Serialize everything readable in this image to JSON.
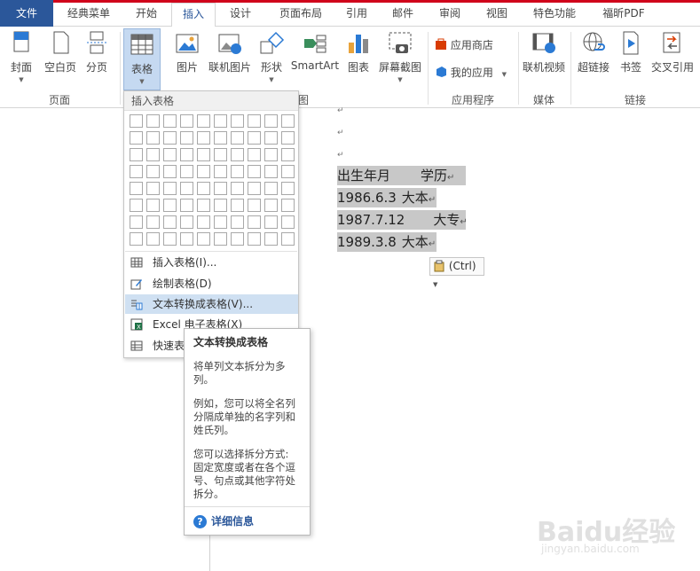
{
  "tabs": [
    "文件",
    "经典菜单",
    "开始",
    "插入",
    "设计",
    "页面布局",
    "引用",
    "邮件",
    "审阅",
    "视图",
    "特色功能",
    "福昕PDF"
  ],
  "ribbon": {
    "pages_group": [
      "封面",
      "空白页",
      "分页"
    ],
    "pages_label": "页面",
    "table_label": "表格",
    "illustrations": [
      "图片",
      "联机图片",
      "形状",
      "SmartArt",
      "图表",
      "屏幕截图"
    ],
    "illus_group_partial": "图",
    "apps": {
      "store": "应用商店",
      "myapps": "我的应用",
      "label": "应用程序"
    },
    "media": {
      "video": "联机视频",
      "label": "媒体"
    },
    "links": {
      "items": [
        "超链接",
        "书签",
        "交叉引用"
      ],
      "label": "链接"
    }
  },
  "dropdown": {
    "header": "插入表格",
    "items": [
      "插入表格(I)...",
      "绘制表格(D)",
      "文本转换成表格(V)...",
      "Excel 电子表格(X)",
      "快速表格(T)"
    ]
  },
  "tooltip": {
    "title": "文本转换成表格",
    "p1": "将单列文本拆分为多列。",
    "p2": "例如，您可以将全名列分隔成单独的名字列和姓氏列。",
    "p3": "您可以选择拆分方式: 固定宽度或者在各个逗号、句点或其他字符处拆分。",
    "more": "详细信息"
  },
  "document": {
    "para_mark": "↵",
    "lines": [
      {
        "a": "出生年月",
        "b": "学历"
      },
      {
        "a": "1986.6.3",
        "b": "大本"
      },
      {
        "a": "1987.7.12",
        "b": "大专"
      },
      {
        "a": "1989.3.8",
        "b": "大本"
      }
    ],
    "paste": "(Ctrl)"
  },
  "watermark": {
    "main": "Baidu经验",
    "sub": "jingyan.baidu.com"
  }
}
